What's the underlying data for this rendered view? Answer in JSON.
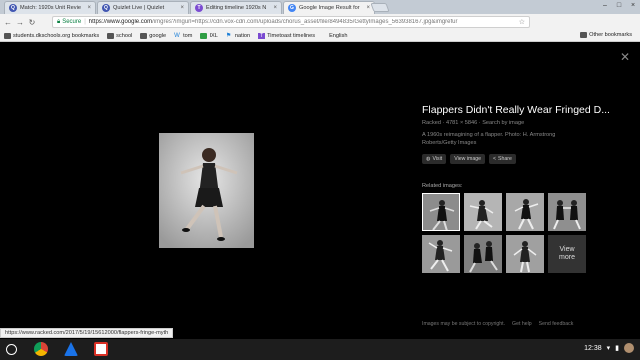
{
  "tabs": [
    {
      "title": "Match: 1920s Unit Revie",
      "favicon": "quizlet-icon",
      "color": "#4257b2",
      "glyph": "Q",
      "active": false
    },
    {
      "title": "Quizlet Live | Quizlet",
      "favicon": "quizlet-icon",
      "color": "#4257b2",
      "glyph": "Q",
      "active": false
    },
    {
      "title": "Editing timeline 1920s N",
      "favicon": "timetoast-icon",
      "color": "#7b4bd1",
      "glyph": "T",
      "active": false
    },
    {
      "title": "Google Image Result for",
      "favicon": "google-icon",
      "color": "#4285f4",
      "glyph": "G",
      "active": true
    }
  ],
  "address": {
    "secure_label": "Secure",
    "url_prefix": "https://www.google.com",
    "url_rest": "/imgres?imgurl=https://cdn.vox-cdn.com/uploads/chorus_asset/file/8494835/GettyImages_563938167.jpg&imgrefur"
  },
  "bookmarks": [
    {
      "label": "students.dkschools.org bookmarks",
      "icon": "folder"
    },
    {
      "label": "school",
      "icon": "folder"
    },
    {
      "label": "google",
      "icon": "folder"
    },
    {
      "label": "tom",
      "icon": "w-icon"
    },
    {
      "label": "IXL",
      "icon": "ixl-icon"
    },
    {
      "label": "nation",
      "icon": "flag-icon"
    },
    {
      "label": "Timetoast timelines",
      "icon": "timetoast-icon"
    },
    {
      "label": "English",
      "icon": "none"
    }
  ],
  "other_bookmarks": "Other bookmarks",
  "result": {
    "title": "Flappers Didn't Really Wear Fringed D...",
    "source": "Racked",
    "dimensions": "4781 × 5846",
    "search_link": "Search by image",
    "description": "A 1960s reimagining of a flapper. Photo: H. Armstrong Roberts/Getty Images",
    "buttons": [
      "Visit",
      "View image",
      "Share"
    ],
    "related_label": "Related images:",
    "view_more": "View more",
    "footer": [
      "Images may be subject to copyright.",
      "Get help",
      "Send feedback"
    ]
  },
  "status_url": "https://www.racked.com/2017/5/19/15612000/flappers-fringe-myth",
  "tray": {
    "time": "12:38"
  },
  "colors": {
    "background": "#000000",
    "panel_title": "#ffffff",
    "secure": "#0b8043"
  }
}
